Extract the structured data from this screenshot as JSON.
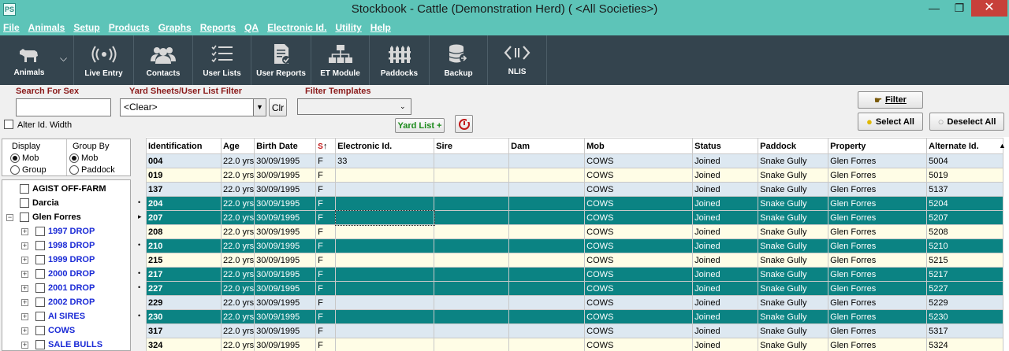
{
  "window": {
    "app_icon_label": "PS",
    "title": "Stockbook - Cattle (Demonstration Herd) ( <All Societies>)"
  },
  "menu": [
    "File",
    "Animals",
    "Setup",
    "Products",
    "Graphs",
    "Reports",
    "QA",
    "Electronic Id.",
    "Utility",
    "Help"
  ],
  "toolbar": {
    "animals": "Animals",
    "live_entry": "Live Entry",
    "contacts": "Contacts",
    "user_lists": "User Lists",
    "user_reports": "User Reports",
    "et_module": "ET Module",
    "paddocks": "Paddocks",
    "backup": "Backup",
    "nlis": "NLIS"
  },
  "filters": {
    "search_label": "Search For Sex",
    "search_value": "",
    "yard_label": "Yard Sheets/User List Filter",
    "yard_value": "<Clear>",
    "clr_label": "Clr",
    "templates_label": "Filter Templates",
    "templates_value": "",
    "alter_width_label": "Alter Id. Width",
    "yard_list_label": "Yard List +",
    "filter_label": "Filter",
    "select_all_label": "Select All",
    "deselect_all_label": "Deselect All"
  },
  "left": {
    "display_label": "Display",
    "display_options": [
      "Mob",
      "Group"
    ],
    "groupby_label": "Group By",
    "groupby_options": [
      "Mob",
      "Paddock"
    ],
    "tree": [
      {
        "label": "AGIST OFF-FARM",
        "level": 0,
        "expander": false
      },
      {
        "label": "Darcia",
        "level": 0,
        "expander": false
      },
      {
        "label": "Glen Forres",
        "level": 0,
        "expander": true,
        "expanded": true
      },
      {
        "label": "1997 DROP",
        "level": 1,
        "expander": true
      },
      {
        "label": "1998 DROP",
        "level": 1,
        "expander": true
      },
      {
        "label": "1999 DROP",
        "level": 1,
        "expander": true
      },
      {
        "label": "2000 DROP",
        "level": 1,
        "expander": true
      },
      {
        "label": "2001 DROP",
        "level": 1,
        "expander": true
      },
      {
        "label": "2002 DROP",
        "level": 1,
        "expander": true
      },
      {
        "label": "AI SIRES",
        "level": 1,
        "expander": true
      },
      {
        "label": "COWS",
        "level": 1,
        "expander": true
      },
      {
        "label": "SALE BULLS",
        "level": 1,
        "expander": true
      }
    ]
  },
  "grid": {
    "sort_arrow": "↑",
    "columns": [
      "Identification",
      "Age",
      "Birth Date",
      "S",
      "Electronic Id.",
      "Sire",
      "Dam",
      "Mob",
      "Status",
      "Paddock",
      "Property",
      "Alternate Id."
    ],
    "rows": [
      {
        "style": "blue",
        "mark": "",
        "cells": [
          "004",
          "22.0 yrs",
          "30/09/1995",
          "F",
          "33",
          "",
          "",
          "COWS",
          "Joined",
          "Snake Gully",
          "Glen Forres",
          "5004"
        ]
      },
      {
        "style": "yellow",
        "mark": "",
        "cells": [
          "019",
          "22.0 yrs",
          "30/09/1995",
          "F",
          "",
          "",
          "",
          "COWS",
          "Joined",
          "Snake Gully",
          "Glen Forres",
          "5019"
        ]
      },
      {
        "style": "blue",
        "mark": "",
        "cells": [
          "137",
          "22.0 yrs",
          "30/09/1995",
          "F",
          "",
          "",
          "",
          "COWS",
          "Joined",
          "Snake Gully",
          "Glen Forres",
          "5137"
        ]
      },
      {
        "style": "teal",
        "mark": "•",
        "cells": [
          "204",
          "22.0 yrs",
          "30/09/1995",
          "F",
          "",
          "",
          "",
          "COWS",
          "Joined",
          "Snake Gully",
          "Glen Forres",
          "5204"
        ]
      },
      {
        "style": "teal",
        "mark": "▸",
        "cells": [
          "207",
          "22.0 yrs",
          "30/09/1995",
          "F",
          "",
          "",
          "",
          "COWS",
          "Joined",
          "Snake Gully",
          "Glen Forres",
          "5207"
        ]
      },
      {
        "style": "yellow",
        "mark": "",
        "cells": [
          "208",
          "22.0 yrs",
          "30/09/1995",
          "F",
          "",
          "",
          "",
          "COWS",
          "Joined",
          "Snake Gully",
          "Glen Forres",
          "5208"
        ]
      },
      {
        "style": "teal",
        "mark": "•",
        "cells": [
          "210",
          "22.0 yrs",
          "30/09/1995",
          "F",
          "",
          "",
          "",
          "COWS",
          "Joined",
          "Snake Gully",
          "Glen Forres",
          "5210"
        ]
      },
      {
        "style": "yellow",
        "mark": "",
        "cells": [
          "215",
          "22.0 yrs",
          "30/09/1995",
          "F",
          "",
          "",
          "",
          "COWS",
          "Joined",
          "Snake Gully",
          "Glen Forres",
          "5215"
        ]
      },
      {
        "style": "teal",
        "mark": "•",
        "cells": [
          "217",
          "22.0 yrs",
          "30/09/1995",
          "F",
          "",
          "",
          "",
          "COWS",
          "Joined",
          "Snake Gully",
          "Glen Forres",
          "5217"
        ]
      },
      {
        "style": "teal",
        "mark": "•",
        "cells": [
          "227",
          "22.0 yrs",
          "30/09/1995",
          "F",
          "",
          "",
          "",
          "COWS",
          "Joined",
          "Snake Gully",
          "Glen Forres",
          "5227"
        ]
      },
      {
        "style": "blue",
        "mark": "",
        "cells": [
          "229",
          "22.0 yrs",
          "30/09/1995",
          "F",
          "",
          "",
          "",
          "COWS",
          "Joined",
          "Snake Gully",
          "Glen Forres",
          "5229"
        ]
      },
      {
        "style": "teal",
        "mark": "•",
        "cells": [
          "230",
          "22.0 yrs",
          "30/09/1995",
          "F",
          "",
          "",
          "",
          "COWS",
          "Joined",
          "Snake Gully",
          "Glen Forres",
          "5230"
        ]
      },
      {
        "style": "blue",
        "mark": "",
        "cells": [
          "317",
          "22.0 yrs",
          "30/09/1995",
          "F",
          "",
          "",
          "",
          "COWS",
          "Joined",
          "Snake Gully",
          "Glen Forres",
          "5317"
        ]
      },
      {
        "style": "yellow",
        "mark": "",
        "cells": [
          "324",
          "22.0 yrs",
          "30/09/1995",
          "F",
          "",
          "",
          "",
          "COWS",
          "Joined",
          "Snake Gully",
          "Glen Forres",
          "5324"
        ]
      }
    ]
  },
  "colors": {
    "titlebar": "#5dc4b8",
    "toolbar": "#34444e",
    "row_selected": "#0b8383",
    "row_blue": "#dde8f1",
    "row_yellow": "#fffde6",
    "label_red": "#8b1a1a",
    "tree_blue": "#1b2bd6"
  }
}
